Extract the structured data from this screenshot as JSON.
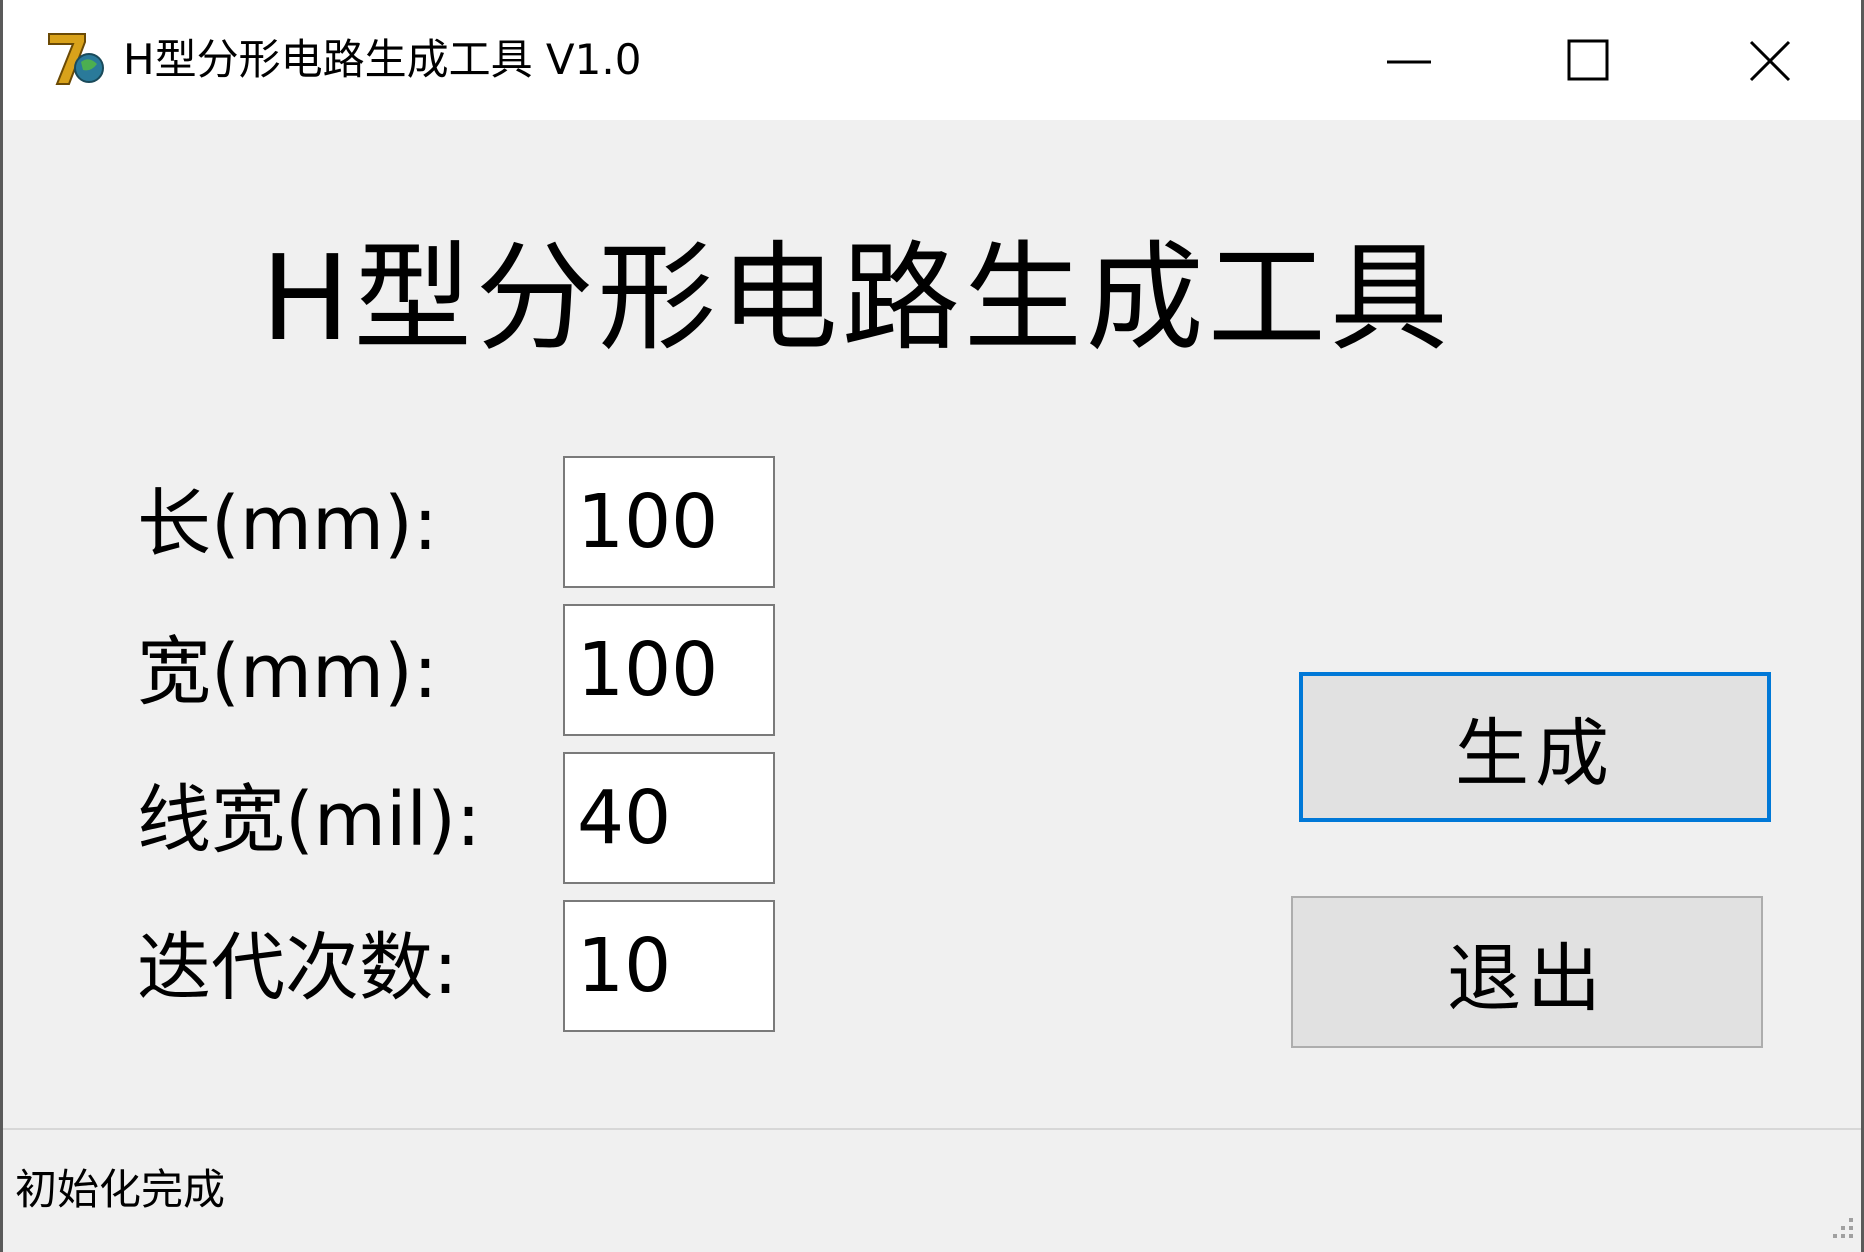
{
  "window": {
    "title": "H型分形电路生成工具 V1.0",
    "icon": "app-logo-icon",
    "controls": {
      "minimize_icon": "minimize-icon",
      "maximize_icon": "maximize-icon",
      "close_icon": "close-icon"
    }
  },
  "main": {
    "heading": "H型分形电路生成工具",
    "fields": [
      {
        "label": "长(mm):",
        "value": "100"
      },
      {
        "label": "宽(mm):",
        "value": "100"
      },
      {
        "label": "线宽(mil):",
        "value": "40"
      },
      {
        "label": "迭代次数:",
        "value": "10"
      }
    ],
    "buttons": {
      "generate": "生成",
      "exit": "退出"
    }
  },
  "status": {
    "text": "初始化完成"
  },
  "colors": {
    "focus_border": "#0078d7",
    "button_face": "#e1e1e1",
    "window_bg": "#f0f0f0"
  }
}
